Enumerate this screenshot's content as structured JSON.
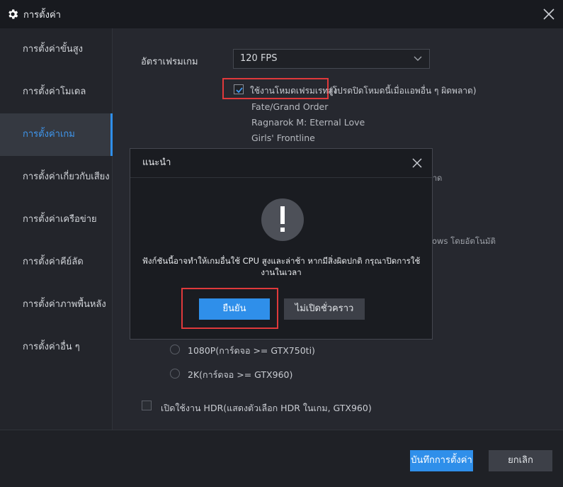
{
  "window": {
    "title": "การตั้งค่า"
  },
  "sidebar": {
    "items": [
      {
        "label": "การตั้งค่าขั้นสูง"
      },
      {
        "label": "การตั้งค่าโมเดล"
      },
      {
        "label": "การตั้งค่าเกม",
        "active": true
      },
      {
        "label": "การตั้งค่าเกี่ยวกับเสียง"
      },
      {
        "label": "การตั้งค่าเครือข่าย"
      },
      {
        "label": "การตั้งค่าคีย์ลัด"
      },
      {
        "label": "การตั้งค่าภาพพื้นหลัง"
      },
      {
        "label": "การตั้งค่าอื่น ๆ"
      }
    ]
  },
  "game": {
    "fps_label": "อัตราเฟรมเกม",
    "fps_value": "120 FPS",
    "high_fps_label": "ใช้งานโหมดเฟรมเรทสูง",
    "high_fps_checked": true,
    "high_fps_note": "(โปรดปิดโหมดนี้เมื่อแอพอื่น ๆ ผิดพลาด)",
    "games": [
      "Fate/Grand Order",
      "Ragnarok M: Eternal Love",
      "Girls' Frontline"
    ],
    "partial_hint_1": "าด",
    "partial_hint_2": "ows โดยอัตโนมัติ",
    "resolutions": [
      {
        "label": "1080P(การ์ดจอ >= GTX750ti)"
      },
      {
        "label": "2K(การ์ดจอ >= GTX960)"
      }
    ],
    "hdr_label": "เปิดใช้งาน HDR(แสดงตัวเลือก HDR ในเกม, GTX960)"
  },
  "footer": {
    "save_label": "บันทึกการตั้งค่า",
    "cancel_label": "ยกเลิก"
  },
  "dialog": {
    "title": "แนะนำ",
    "message": "ฟังก์ชันนี้อาจทำให้เกมอื่นใช้ CPU สูงและล่าช้า หากมีสิ่งผิดปกติ กรุณาปิดการใช้งานในเวลา",
    "confirm_label": "ยืนยัน",
    "disable_label": "ไม่เปิดชั่วคราว"
  },
  "colors": {
    "accent": "#2f8fea",
    "highlight": "#e0393b",
    "background": "#23252b"
  }
}
